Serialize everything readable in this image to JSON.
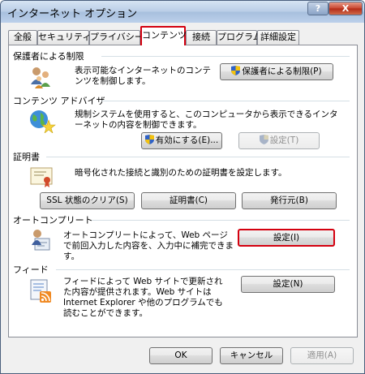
{
  "window": {
    "title": "インターネット オプション",
    "help": "?",
    "close": "X"
  },
  "tabs": [
    {
      "label": "全般"
    },
    {
      "label": "セキュリティ"
    },
    {
      "label": "プライバシー"
    },
    {
      "label": "コンテンツ",
      "active": true
    },
    {
      "label": "接続"
    },
    {
      "label": "プログラム"
    },
    {
      "label": "詳細設定"
    }
  ],
  "parental": {
    "title": "保護者による制限",
    "desc": "表示可能なインターネットのコンテンツを制御します。",
    "button": "保護者による制限(P)",
    "icon": "family-users-icon"
  },
  "advisor": {
    "title": "コンテンツ アドバイザ",
    "desc": "規制システムを使用すると、このコンピュータから表示できるインターネットの内容を制御できます。",
    "enable_button": "有効にする(E)...",
    "settings_button": "設定(T)",
    "icon": "globe-star-icon"
  },
  "certificates": {
    "title": "証明書",
    "desc": "暗号化された接続と識別のための証明書を設定します。",
    "ssl_button": "SSL 状態のクリア(S)",
    "cert_button": "証明書(C)",
    "publisher_button": "発行元(B)",
    "icon": "certificate-icon"
  },
  "autocomplete": {
    "title": "オートコンプリート",
    "desc": "オートコンプリートによって、Web ページで前回入力した内容を、入力中に補完できます。",
    "settings_button": "設定(I)",
    "icon": "autocomplete-user-icon"
  },
  "feeds": {
    "title": "フィード",
    "desc": "フィードによって Web サイトで更新された内容が提供されます。Web サイトは Internet Explorer や他のプログラムでも読むことができます。",
    "settings_button": "設定(N)",
    "icon": "feed-icon"
  },
  "footer": {
    "ok": "OK",
    "cancel": "キャンセル",
    "apply": "適用(A)"
  },
  "colors": {
    "highlight": "#d4000f",
    "titlebar": "#b9cde6"
  }
}
